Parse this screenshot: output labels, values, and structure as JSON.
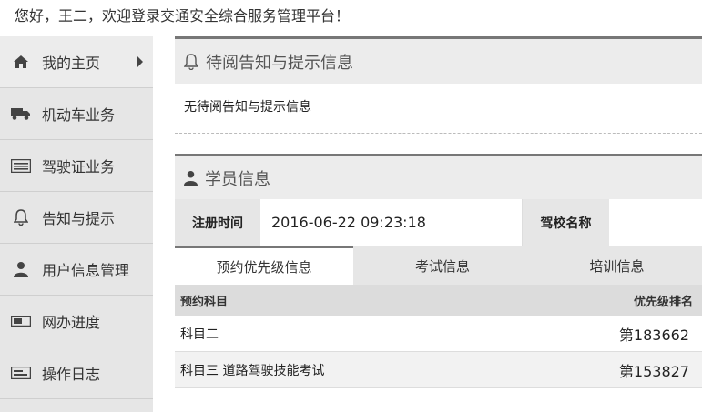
{
  "header": {
    "welcome": "您好，王二，欢迎登录交通安全综合服务管理平台！"
  },
  "sidebar": {
    "items": [
      {
        "label": "我的主页",
        "icon": "home-icon"
      },
      {
        "label": "机动车业务",
        "icon": "truck-icon"
      },
      {
        "label": "驾驶证业务",
        "icon": "license-card-icon"
      },
      {
        "label": "告知与提示",
        "icon": "bell-icon"
      },
      {
        "label": "用户信息管理",
        "icon": "user-icon"
      },
      {
        "label": "网办进度",
        "icon": "progress-icon"
      },
      {
        "label": "操作日志",
        "icon": "log-icon"
      }
    ]
  },
  "notice": {
    "title": "待阅告知与提示信息",
    "body": "无待阅告知与提示信息"
  },
  "student": {
    "title": "学员信息",
    "reg_time_label": "注册时间",
    "reg_time_value": "2016-06-22  09:23:18",
    "school_label": "驾校名称",
    "school_value": ""
  },
  "tabs": [
    {
      "label": "预约优先级信息"
    },
    {
      "label": "考试信息"
    },
    {
      "label": "培训信息"
    }
  ],
  "table": {
    "headers": [
      "预约科目",
      "优先级排名"
    ],
    "rows": [
      [
        "科目二",
        "第183662"
      ],
      [
        "科目三 道路驾驶技能考试",
        "第153827"
      ]
    ]
  }
}
